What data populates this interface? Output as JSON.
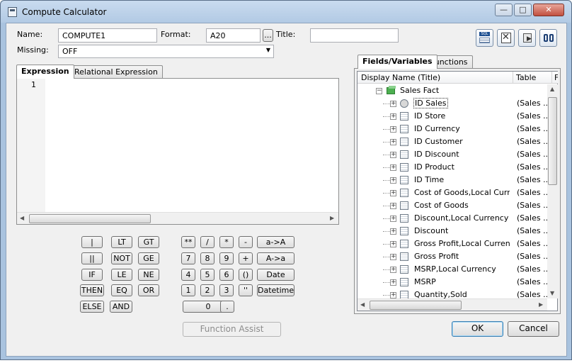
{
  "window": {
    "title": "Compute Calculator",
    "minimize": "—",
    "maximize": "□",
    "close": "✕"
  },
  "form": {
    "name_label": "Name:",
    "name_value": "COMPUTE1",
    "format_label": "Format:",
    "format_value": "A20",
    "format_browse": "...",
    "title_label": "Title:",
    "title_value": "",
    "missing_label": "Missing:",
    "missing_value": "OFF"
  },
  "toolbar_icons": [
    "sql-icon",
    "validate-icon",
    "export-icon",
    "find-icon"
  ],
  "editor": {
    "tabs": [
      "Expression",
      "Relational Expression"
    ],
    "active_tab": "Expression",
    "line_number": "1",
    "content": ""
  },
  "keypad": {
    "logic": [
      [
        "|",
        "LT",
        "GT"
      ],
      [
        "||",
        "NOT",
        "GE"
      ],
      [
        "IF",
        "LE",
        "NE"
      ],
      [
        "THEN",
        "EQ",
        "OR"
      ],
      [
        "ELSE",
        "AND"
      ]
    ],
    "arith": [
      [
        "**",
        "/",
        "*",
        "-",
        "a->A"
      ],
      [
        "7",
        "8",
        "9",
        "+",
        "A->a"
      ],
      [
        "4",
        "5",
        "6",
        "()",
        "Date"
      ],
      [
        "1",
        "2",
        "3",
        "''",
        "Datetime"
      ],
      [
        "0",
        "."
      ]
    ],
    "function_assist": "Function Assist"
  },
  "fields": {
    "tabs": [
      "Fields/Variables",
      "Functions"
    ],
    "active_tab": "Fields/Variables",
    "columns": [
      "Display Name (Title)",
      "Table",
      "F"
    ],
    "root": "Sales Fact",
    "rows": [
      {
        "name": "ID Sales",
        "table": "(Sales ..."
      },
      {
        "name": "ID Store",
        "table": "(Sales ..."
      },
      {
        "name": "ID Currency",
        "table": "(Sales ..."
      },
      {
        "name": "ID Customer",
        "table": "(Sales ..."
      },
      {
        "name": "ID Discount",
        "table": "(Sales ..."
      },
      {
        "name": "ID Product",
        "table": "(Sales ..."
      },
      {
        "name": "ID Time",
        "table": "(Sales ..."
      },
      {
        "name": "Cost of Goods,Local Curr...",
        "table": "(Sales ..."
      },
      {
        "name": "Cost of Goods",
        "table": "(Sales ..."
      },
      {
        "name": "Discount,Local Currency",
        "table": "(Sales ..."
      },
      {
        "name": "Discount",
        "table": "(Sales ..."
      },
      {
        "name": "Gross Profit,Local Currency",
        "table": "(Sales ..."
      },
      {
        "name": "Gross Profit",
        "table": "(Sales ..."
      },
      {
        "name": "MSRP,Local Currency",
        "table": "(Sales ..."
      },
      {
        "name": "MSRP",
        "table": "(Sales ..."
      },
      {
        "name": "Quantity,Sold",
        "table": "(Sales ..."
      }
    ]
  },
  "dialog": {
    "ok": "OK",
    "cancel": "Cancel"
  }
}
